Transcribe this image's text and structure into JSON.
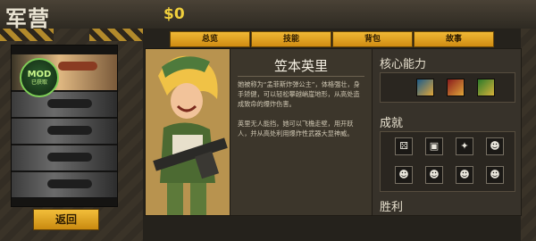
{
  "header": {
    "title": "军营",
    "money": "$0"
  },
  "tabs": [
    "总览",
    "技能",
    "背包",
    "故事"
  ],
  "character": {
    "name": "笠本英里",
    "description_1": "她被称为“孟菲斯炸弹公主”，体格强壮，身手矫健，可以轻松攀越峭崖地形，从高处造成致命的爆炸伤害。",
    "description_2": "英里无人能挡，她可以飞檐走壁，用开跃人，并从高处利用爆炸性武器大显神威。"
  },
  "sections": {
    "core": "核心能力",
    "achievements": "成就",
    "victory": "胜利"
  },
  "skill_icons": [
    "bomb-skill-icon",
    "explosion-skill-icon",
    "grenade-skill-icon"
  ],
  "achievement_icons": [
    "dice-icon",
    "tank-icon",
    "target-icon",
    "soldier-icon",
    "soldier-icon",
    "soldier-icon",
    "soldier-icon",
    "soldier-icon"
  ],
  "roster": {
    "badge_text": "MOD",
    "badge_sub": "已获取"
  },
  "back_button": "返回",
  "colors": {
    "accent": "#f0b835",
    "money": "#f0cf3c",
    "badge": "#7fcf57"
  }
}
